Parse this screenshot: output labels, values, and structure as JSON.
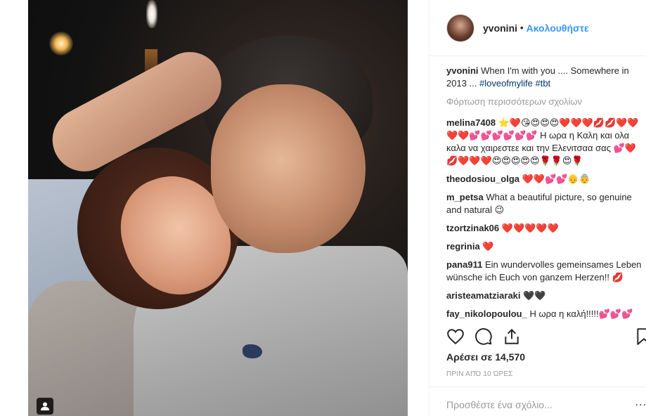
{
  "header": {
    "username": "yvonini",
    "follow_label": "Ακολουθήστε"
  },
  "caption": {
    "username": "yvonini",
    "text": "When I'm with you .... Somewhere in 2013 ... ",
    "hashtag1": "#loveofmylife",
    "hashtag2": "#tbt"
  },
  "load_more_label": "Φόρτωση περισσότερων σχολίων",
  "comments": [
    {
      "username": "melina7408",
      "text": "⭐❤️😘😍😍😍❤️❤️❤️💋💋❤️❤️❤️❤️💕💕💕💕💕💕 Η ωρα η Καλη και ολα καλα να χαιρεστεε και την Ελενιτσαα σας 💕❤️💋❤️❤️❤️😍😍😍😍😍🌹🌹😍🌹"
    },
    {
      "username": "theodosiou_olga",
      "text": "❤️❤️💕💕👴👵"
    },
    {
      "username": "m_petsa",
      "text": "What a beautiful picture, so genuine and natural 😉"
    },
    {
      "username": "tzortzinak06",
      "text": "❤️❤️❤️❤️❤️"
    },
    {
      "username": "regrinia",
      "text": "❤️"
    },
    {
      "username": "pana911",
      "text": "Ein wundervolles gemeinsames Leben wünsche ich Euch von ganzem Herzen!! 💋"
    },
    {
      "username": "aristeamatziaraki",
      "text": "🖤🖤"
    },
    {
      "username": "fay_nikolopoulou_",
      "text": "Η ωρα η καλή!!!!!💕💕💕"
    }
  ],
  "likes": "Αρέσει σε 14,570",
  "timestamp": "ΠΡΙΝ ΑΠΌ 10 ΏΡΕΣ",
  "comment_input": {
    "placeholder": "Προσθέστε ένα σχόλιο...",
    "more_label": "..."
  },
  "icons": {
    "like": "heart-icon",
    "comment": "comment-icon",
    "share": "share-icon",
    "save": "bookmark-icon",
    "tag": "user-tag-icon"
  },
  "colors": {
    "link_blue": "#3897f0",
    "hashtag": "#003569",
    "muted": "#999999",
    "text": "#262626"
  }
}
